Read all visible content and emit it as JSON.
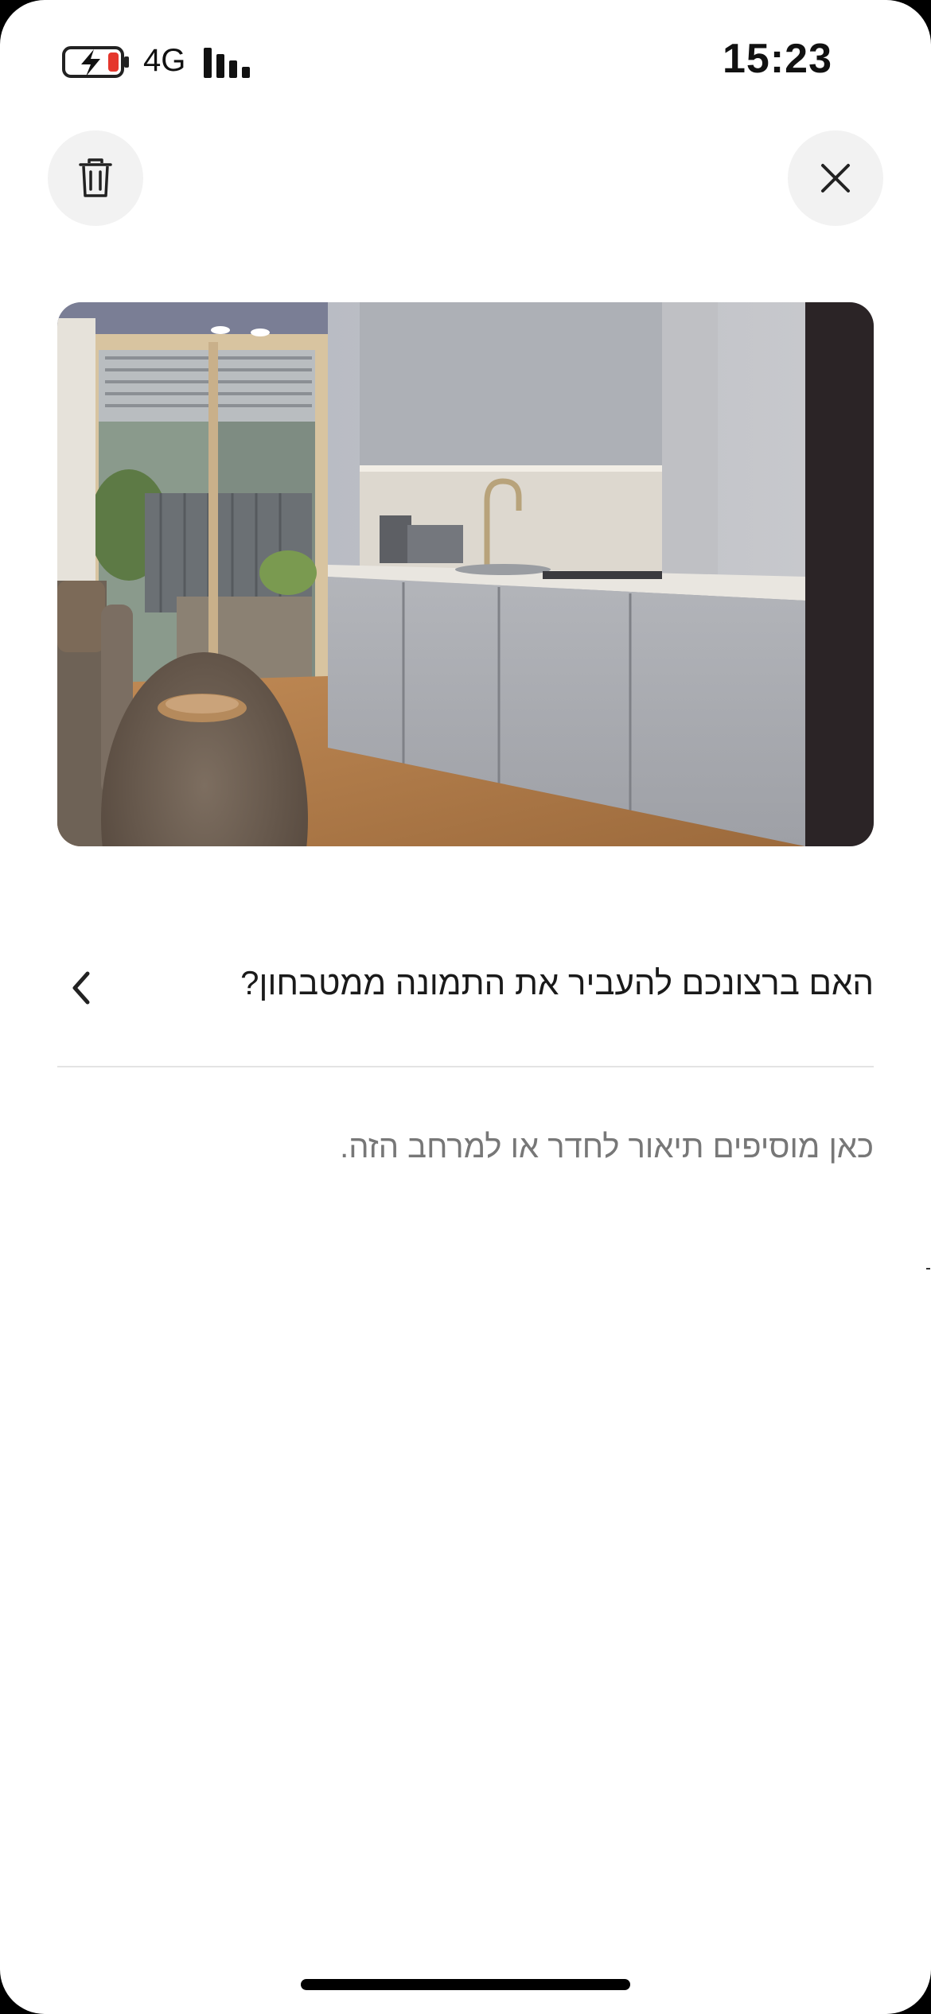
{
  "status_bar": {
    "network": "4G",
    "time": "15:23",
    "battery_icon": "battery-charging-low-icon",
    "signal_icon": "cellular-signal-icon"
  },
  "toolbar": {
    "delete_icon": "trash-icon",
    "close_icon": "close-icon"
  },
  "photo": {
    "subject": "kitchenette-room-photo"
  },
  "question": {
    "text": "האם ברצונכם להעביר את התמונה ממטבחון?",
    "chevron_icon": "chevron-left-icon"
  },
  "description": {
    "placeholder": "כאן מוסיפים תיאור לחדר או למרחב הזה."
  },
  "colors": {
    "background": "#ffffff",
    "button_bg": "#f2f2f2",
    "text_primary": "#1a1a1a",
    "text_secondary": "#777777",
    "battery_low": "#e5372d"
  }
}
